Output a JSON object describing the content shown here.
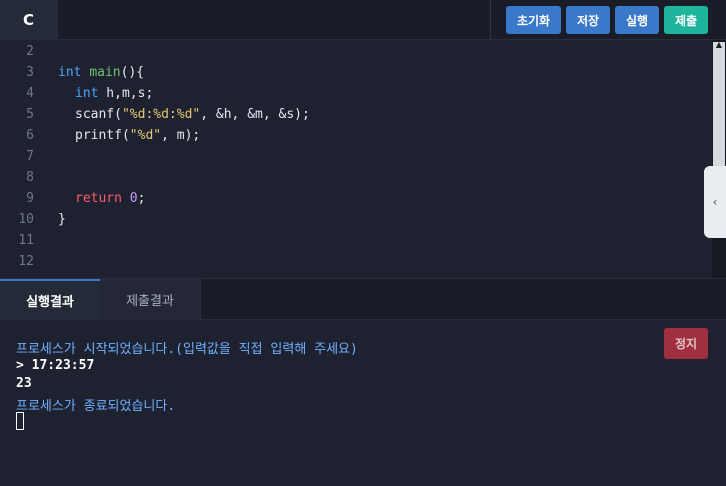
{
  "header": {
    "language": "C",
    "buttons": {
      "reset": "초기화",
      "save": "저장",
      "run": "실행",
      "submit": "제출"
    }
  },
  "editor": {
    "line_numbers": [
      "2",
      "3",
      "4",
      "5",
      "6",
      "7",
      "8",
      "9",
      "10",
      "11",
      "12"
    ],
    "code": {
      "l3_type": "int",
      "l3_fn": "main",
      "l3_rest": "(){",
      "l4_type": "int",
      "l4_rest": " h,m,s;",
      "l5_fn": "scanf(",
      "l5_str": "\"%d:%d:%d\"",
      "l5_rest": ", &h, &m, &s);",
      "l6_fn": "printf(",
      "l6_str": "\"%d\"",
      "l6_rest": ", m);",
      "l9_kw": "return",
      "l9_num": "0",
      "l9_rest": ";",
      "l10": "}"
    }
  },
  "result_tabs": {
    "run_result": "실행결과",
    "submit_result": "제출결과"
  },
  "console": {
    "lines": [
      "프로세스가 시작되었습니다.(입력값을 직접 입력해 주세요)",
      "> 17:23:57",
      "23",
      "프로세스가 종료되었습니다."
    ],
    "stop_label": "정지"
  },
  "colors": {
    "primary_button": "#3a78c9",
    "submit_button": "#1fb59c",
    "stop_button": "#a03040",
    "console_info": "#6fb0ff"
  }
}
